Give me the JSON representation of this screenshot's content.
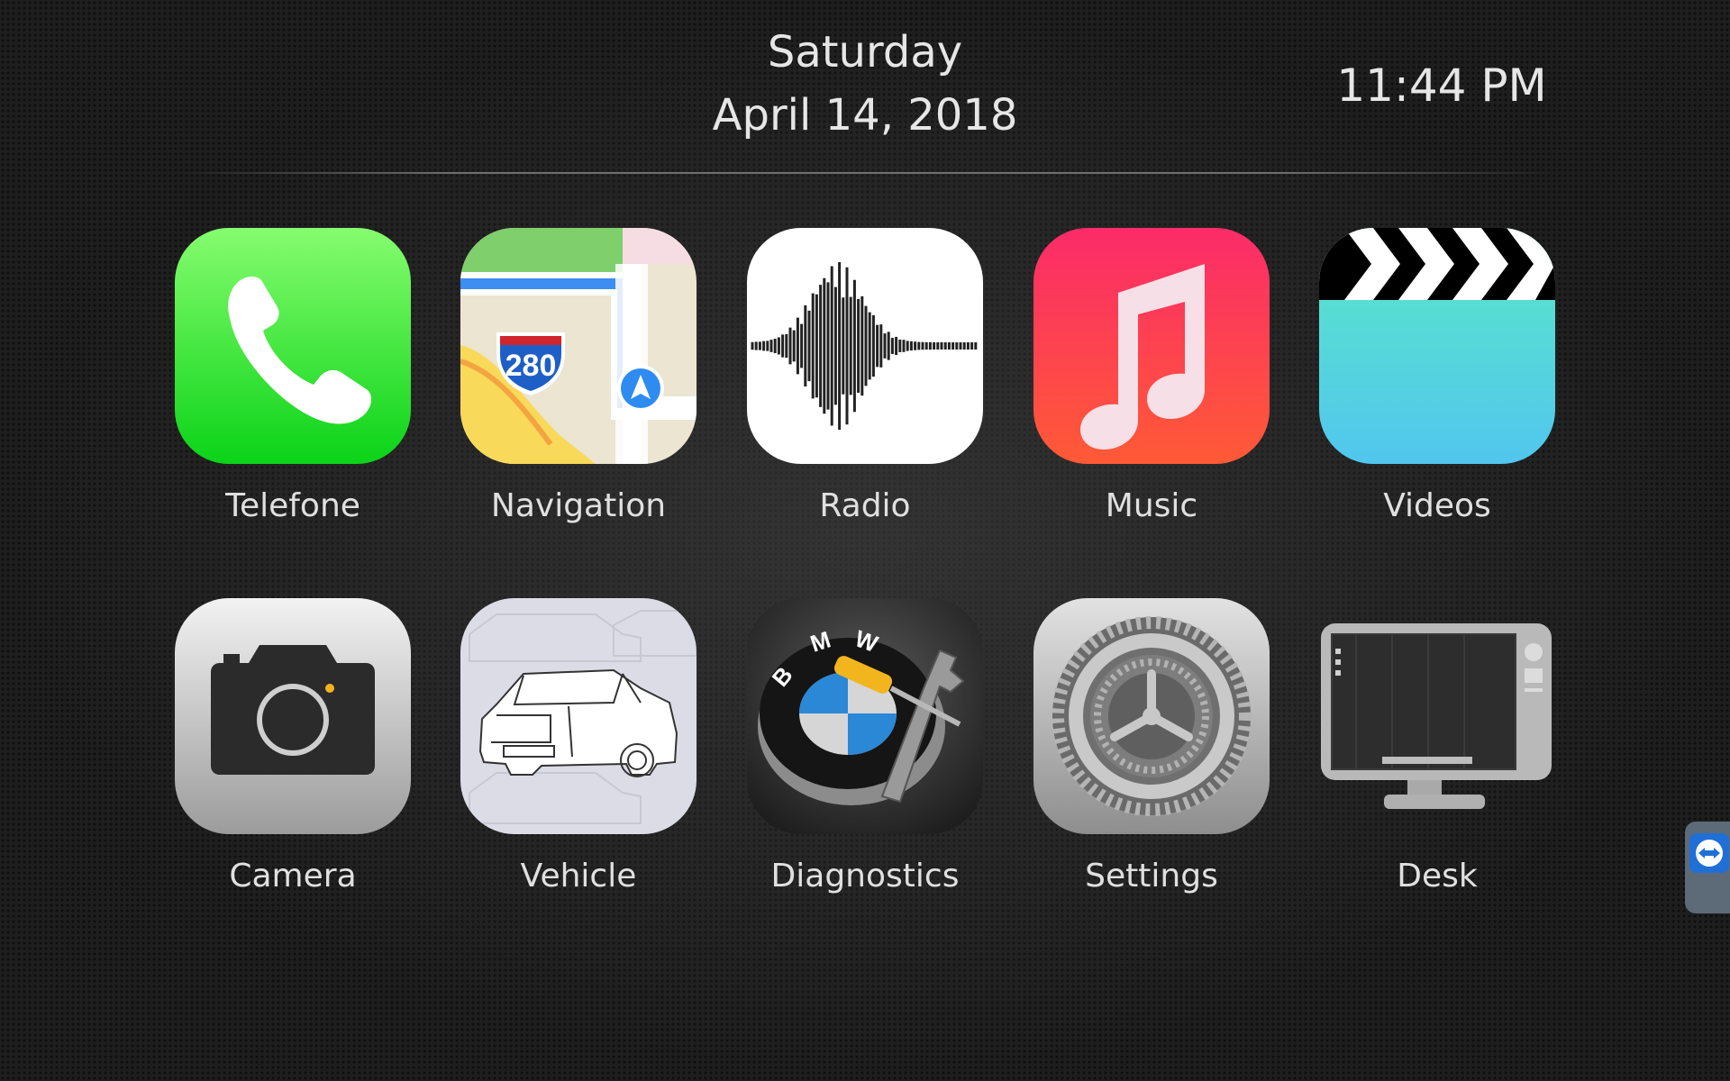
{
  "header": {
    "day": "Saturday",
    "date": "April 14, 2018",
    "time": "11:44 PM"
  },
  "apps": [
    {
      "label": "Telefone",
      "icon": "phone-icon"
    },
    {
      "label": "Navigation",
      "icon": "map-icon"
    },
    {
      "label": "Radio",
      "icon": "voice-memo-waveform-icon"
    },
    {
      "label": "Music",
      "icon": "music-note-icon"
    },
    {
      "label": "Videos",
      "icon": "clapperboard-icon"
    },
    {
      "label": "Camera",
      "icon": "camera-icon"
    },
    {
      "label": "Vehicle",
      "icon": "car-sketch-icon"
    },
    {
      "label": "Diagnostics",
      "icon": "bmw-diagnostics-icon"
    },
    {
      "label": "Settings",
      "icon": "gear-icon"
    },
    {
      "label": "Desk",
      "icon": "monitor-icon"
    }
  ],
  "map_shield_text": "280",
  "bmw_letters": [
    "B",
    "M",
    "W"
  ],
  "colors": {
    "phone_green": "#2fd142",
    "music_red": "#fc3d5a",
    "videos_teal": "#5ee6cf",
    "interstate_blue": "#1d5fc6",
    "nav_arrow_blue": "#2e8cf0"
  }
}
